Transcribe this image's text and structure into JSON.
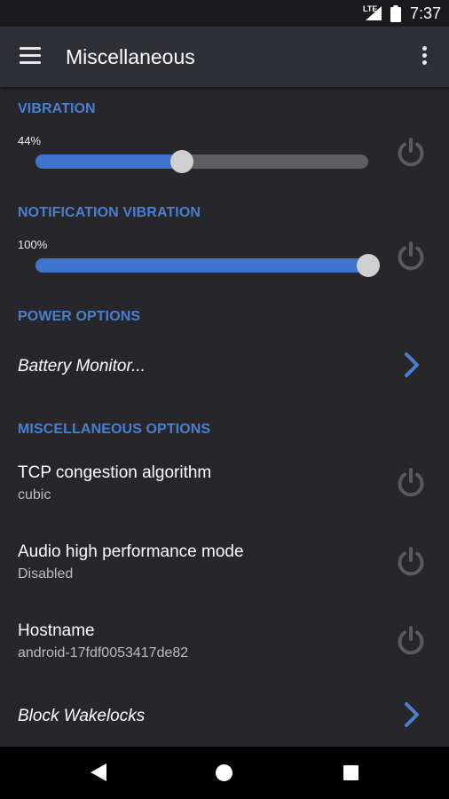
{
  "status_bar": {
    "network": "LTE",
    "time": "7:37"
  },
  "toolbar": {
    "title": "Miscellaneous",
    "menu_icon": "hamburger-menu-icon",
    "overflow_icon": "more-vert-icon"
  },
  "colors": {
    "accent": "#4a7fd0",
    "slider_fill": "#3f74cc",
    "background": "#26262b",
    "toolbar": "#2f3036"
  },
  "sections": {
    "vibration": {
      "header": "VIBRATION",
      "value_label": "44%",
      "value": 0.44
    },
    "notification_vibration": {
      "header": "NOTIFICATION VIBRATION",
      "value_label": "100%",
      "value": 1.0
    },
    "power_options": {
      "header": "POWER OPTIONS",
      "items": [
        {
          "title": "Battery Monitor..."
        }
      ]
    },
    "misc_options": {
      "header": "MISCELLANEOUS OPTIONS",
      "items": [
        {
          "title": "TCP congestion algorithm",
          "subtitle": "cubic"
        },
        {
          "title": "Audio high performance mode",
          "subtitle": "Disabled"
        },
        {
          "title": "Hostname",
          "subtitle": "android-17fdf0053417de82"
        },
        {
          "title": "Block Wakelocks"
        }
      ]
    }
  }
}
